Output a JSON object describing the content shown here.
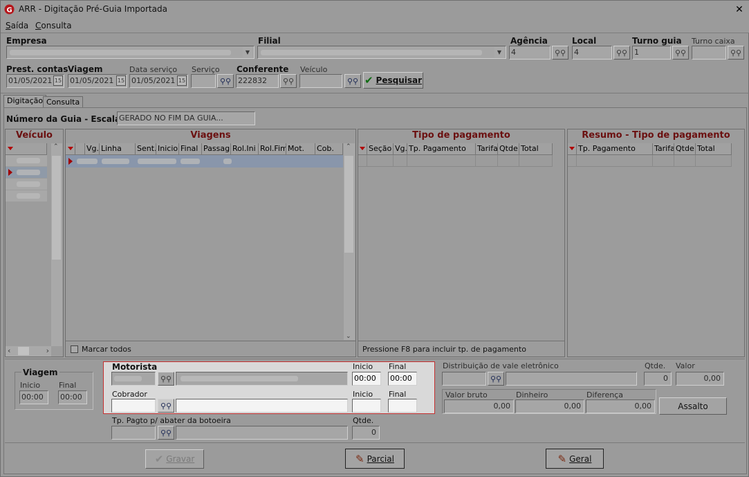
{
  "window": {
    "title": "ARR - Digitação Pré-Guia Importada",
    "close": "✕",
    "app_icon": "app-logo-icon"
  },
  "menu": [
    {
      "label": "Saída",
      "mn": "S"
    },
    {
      "label": "Consulta",
      "mn": "C"
    }
  ],
  "header": {
    "empresa_label": "Empresa",
    "filial_label": "Filial",
    "agencia_label": "Agência",
    "agencia_value": "4",
    "local_label": "Local",
    "local_value": "4",
    "turno_guia_label": "Turno guia",
    "turno_guia_value": "1",
    "turno_caixa_label": "Turno caixa",
    "turno_caixa_value": "",
    "prest_label": "Prest. contas",
    "prest_value": "01/05/2021",
    "viagem_label": "Viagem",
    "viagem_value": "01/05/2021",
    "data_servico_label": "Data serviço",
    "data_servico_value": "01/05/2021",
    "servico_label": "Serviço",
    "servico_value": "",
    "conferente_label": "Conferente",
    "conferente_value": "222832",
    "veiculo_label": "Veículo",
    "veiculo_value": "",
    "pesquisar": "Pesquisar",
    "calendar_glyph": "15"
  },
  "tabs": [
    "Digitação",
    "Consulta"
  ],
  "guia": {
    "label": "Número da Guia - Escala:",
    "value": "GERADO NO FIM DA GUIA..."
  },
  "panels": {
    "veiculo": "Veículo",
    "viagens": "Viagens",
    "tipo_pagamento": "Tipo de pagamento",
    "resumo": "Resumo - Tipo de pagamento"
  },
  "viagens_columns": [
    "Vg.",
    "Linha",
    "Sent.",
    "Inicio",
    "Final",
    "Passag.",
    "Rol.Ini",
    "Rol.Fim",
    "Mot.",
    "Cob."
  ],
  "tipo_columns": [
    "Seção",
    "Vg.",
    "Tp. Pagamento",
    "Tarifa",
    "Qtde.",
    "Total"
  ],
  "resumo_columns": [
    "Tp. Pagamento",
    "Tarifa",
    "Qtde.",
    "Total"
  ],
  "marcar_todos": "Marcar todos",
  "f8_hint": "Pressione F8 para incluir tp. de pagamento",
  "viagem_group": {
    "title": "Viagem",
    "inicio_label": "Inicio",
    "final_label": "Final",
    "inicio": "00:00",
    "final": "00:00"
  },
  "motorista": {
    "label": "Motorista",
    "inicio_label": "Inicio",
    "final_label": "Final",
    "inicio": "00:00",
    "final": "00:00"
  },
  "cobrador": {
    "label": "Cobrador",
    "inicio_label": "Inicio",
    "final_label": "Final",
    "inicio": "",
    "final": ""
  },
  "tp_pagto": {
    "label": "Tp. Pagto p/ abater da botoeira",
    "qtde_label": "Qtde.",
    "qtde": "0"
  },
  "distribuicao": {
    "label": "Distribuição de vale eletrônico",
    "qtde_label": "Qtde.",
    "valor_label": "Valor",
    "qtde": "0",
    "valor": "0,00"
  },
  "valores": {
    "bruto_label": "Valor bruto",
    "dinheiro_label": "Dinheiro",
    "diferenca_label": "Diferença",
    "bruto": "0,00",
    "dinheiro": "0,00",
    "diferenca": "0,00"
  },
  "assalto": "Assalto",
  "buttons": {
    "gravar": "Gravar",
    "parcial": "Parcial",
    "geral": "Geral"
  }
}
